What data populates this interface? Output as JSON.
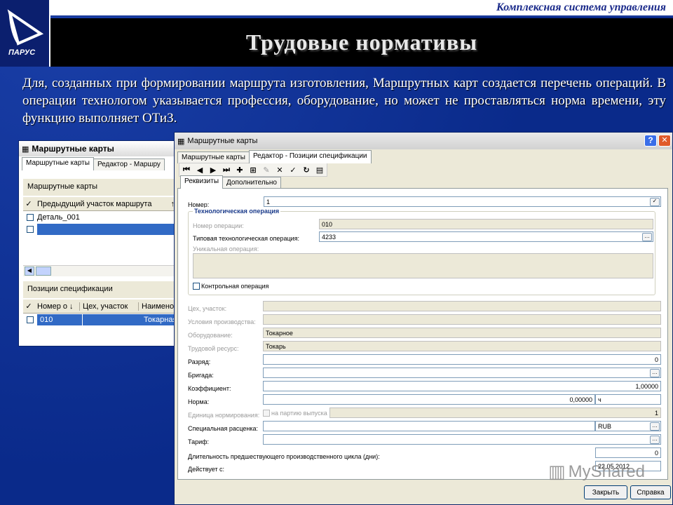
{
  "header": {
    "system_name": "Комплексная система управления",
    "title": "Трудовые нормативы",
    "logo_text": "ПАРУС"
  },
  "paragraph": "Для, созданных при формировании маршрута изготовления, Маршрутных карт создается перечень операций. В операции технологом указывается профессия, оборудование, но может не проставляться норма времени, эту функцию выполняет ОТиЗ.",
  "back_window": {
    "title": "Маршрутные карты",
    "tabs": [
      "Маршрутные карты",
      "Редактор - Маршру"
    ],
    "section1": "Маршрутные карты",
    "grid1": {
      "columns": [
        "Предыдущий участок маршрута"
      ],
      "rows": [
        "Деталь_001",
        ""
      ]
    },
    "section2": "Позиции спецификации",
    "grid2": {
      "columns": [
        "Номер о",
        "Цех, участок",
        "Наимено"
      ],
      "rows": [
        [
          "010",
          "",
          "Токарная"
        ]
      ]
    }
  },
  "front_window": {
    "title": "Маршрутные карты",
    "help": "?",
    "close": "✕",
    "tabs": [
      "Маршрутные карты",
      "Редактор - Позиции спецификации"
    ],
    "subtabs": [
      "Реквизиты",
      "Дополнительно"
    ],
    "fields": {
      "nomer": {
        "label": "Номер:",
        "value": "1"
      },
      "group": "Технологическая операция",
      "nomer_op": {
        "label": "Номер операции:",
        "value": "010"
      },
      "tip_op": {
        "label": "Типовая технологическая операция:",
        "value": "4233"
      },
      "unik_op": {
        "label": "Уникальная операция:"
      },
      "kontrol": "Контрольная операция",
      "ceh": {
        "label": "Цех, участок:",
        "value": ""
      },
      "usl": {
        "label": "Условия производства:",
        "value": ""
      },
      "oborud": {
        "label": "Оборудование:",
        "value": "Токарное"
      },
      "trud": {
        "label": "Трудовой ресурс:",
        "value": "Токарь"
      },
      "razryad": {
        "label": "Разряд:",
        "value": "0"
      },
      "brigada": {
        "label": "Бригада:",
        "value": ""
      },
      "koef": {
        "label": "Коэффициент:",
        "value": "1,00000"
      },
      "norma": {
        "label": "Норма:",
        "value": "0,00000",
        "unit": "ч"
      },
      "ed_norm": {
        "label": "Единица нормирования:",
        "check": "на партию выпуска",
        "value": "1"
      },
      "spec": {
        "label": "Специальная расценка:",
        "value": "",
        "currency": "RUB"
      },
      "tarif": {
        "label": "Тариф:",
        "value": ""
      },
      "dlit": {
        "label": "Длительность предшествующего производственного цикла (дни):",
        "value": "0"
      },
      "deyst": {
        "label": "Действует с:",
        "value": "22.05.2012"
      }
    },
    "buttons": {
      "close": "Закрыть",
      "help": "Справка"
    }
  },
  "watermark": "MyShared"
}
